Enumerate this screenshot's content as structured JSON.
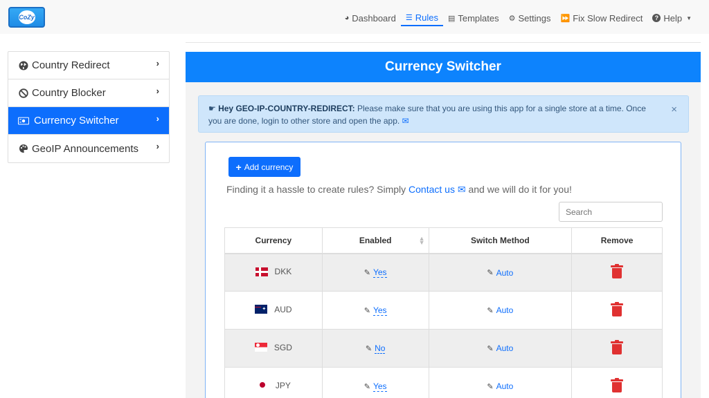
{
  "logo": {
    "text": "CoZy"
  },
  "nav": {
    "items": [
      {
        "icon": "dashboard-icon",
        "glyph": "◕",
        "label": "Dashboard"
      },
      {
        "icon": "list-icon",
        "glyph": "☰",
        "label": "Rules"
      },
      {
        "icon": "templates-icon",
        "glyph": "▤",
        "label": "Templates"
      },
      {
        "icon": "gear-icon",
        "glyph": "⚙",
        "label": "Settings"
      },
      {
        "icon": "fast-forward-icon",
        "glyph": "⏩",
        "label": "Fix Slow Redirect"
      },
      {
        "icon": "help-icon",
        "glyph": "?",
        "label": "Help"
      }
    ],
    "active": "Rules",
    "help_caret": "▼"
  },
  "sidebar": {
    "items": [
      {
        "label": "Country Redirect",
        "icon": "globe-icon",
        "glyph": "🌐"
      },
      {
        "label": "Country Blocker",
        "icon": "ban-icon",
        "glyph": "⊘"
      },
      {
        "label": "Currency Switcher",
        "icon": "money-icon",
        "glyph": "💵"
      },
      {
        "label": "GeoIP Announcements",
        "icon": "palette-icon",
        "glyph": "🎨"
      }
    ],
    "active_index": 2,
    "chevron": "›"
  },
  "page": {
    "title": "Currency Switcher"
  },
  "alert": {
    "icon": "hand-point-right-icon",
    "lead": "Hey GEO-IP-COUNTRY-REDIRECT:",
    "message": "Please make sure that you are using this app for a single store at a time. Once you are done, login to other store and open the app.",
    "envelope": "✉",
    "close": "×"
  },
  "toolbar": {
    "add_label": "Add currency",
    "hint_before": "Finding it a hassle to create rules? Simply ",
    "hint_link": "Contact us",
    "hint_after": " and we will do it for you!",
    "search_placeholder": "Search"
  },
  "table": {
    "headers": [
      "Currency",
      "Enabled",
      "Switch Method",
      "Remove"
    ],
    "rows": [
      {
        "code": "DKK",
        "flag": "dk",
        "enabled": "Yes",
        "method": "Auto"
      },
      {
        "code": "AUD",
        "flag": "au",
        "enabled": "Yes",
        "method": "Auto"
      },
      {
        "code": "SGD",
        "flag": "sg",
        "enabled": "No",
        "method": "Auto"
      },
      {
        "code": "JPY",
        "flag": "jp",
        "enabled": "Yes",
        "method": "Auto"
      }
    ]
  },
  "colors": {
    "accent": "#0d6efd",
    "banner": "#0d83fd",
    "danger": "#e03131",
    "alert_bg": "#cfe6fb"
  }
}
